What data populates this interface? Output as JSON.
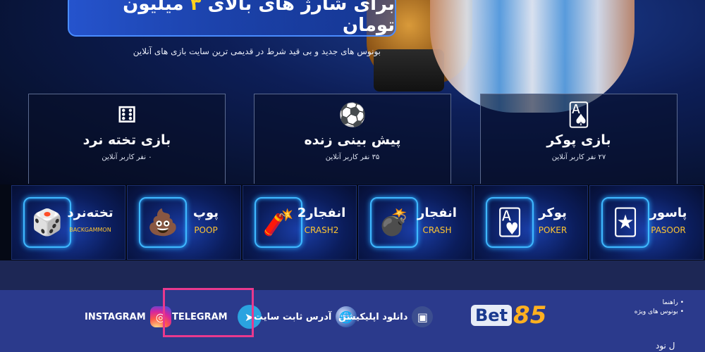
{
  "hero": {
    "promo_title_prefix": "برای شارژ های بالای",
    "promo_title_number": "۳",
    "promo_title_suffix": "میلیون تومان",
    "promo_subtitle": "بونوس های جدید و بی قید شرط در قدیمی ترین سایت بازی های آنلاین"
  },
  "categories": [
    {
      "icon": "dice-icon",
      "glyph": "⚅",
      "title": "بازی تخته نرد",
      "online": "۰ نفر کاربر آنلاین"
    },
    {
      "icon": "soccer-ball-icon",
      "glyph": "⚽",
      "title": "پیش بینی زنده",
      "online": "۳۵ نفر کاربر آنلاین"
    },
    {
      "icon": "playing-cards-icon",
      "glyph": "🂡",
      "title": "بازی پوکر",
      "online": "۲۷ نفر کاربر آنلاین"
    }
  ],
  "games": [
    {
      "name": "تخته‌نرد",
      "sub": "BACKGAMMON",
      "icon": "dice-icon",
      "glyph": "🎲"
    },
    {
      "name": "پوپ",
      "sub": "POOP",
      "icon": "poop-icon",
      "glyph": "💩"
    },
    {
      "name": "انفجار2",
      "sub": "CRASH2",
      "icon": "dynamite-icon",
      "glyph": "🧨"
    },
    {
      "name": "انفجار",
      "sub": "CRASH",
      "icon": "bomb-icon",
      "glyph": "💣"
    },
    {
      "name": "پوکر",
      "sub": "POKER",
      "icon": "poker-chips-icon",
      "glyph": "🂱"
    },
    {
      "name": "پاسور",
      "sub": "PASOOR",
      "icon": "card-fan-icon",
      "glyph": "🃏"
    }
  ],
  "footer": {
    "instagram_label": "INSTAGRAM",
    "telegram_label": "TELEGRAM",
    "address_label": "آدرس ثابت سایت",
    "app_label": "دانلود اپلیکیشن",
    "logo_text": "Bet",
    "logo_num": "85",
    "links": [
      "راهنما",
      "بونوس های ویژه"
    ],
    "more_text": "ل نود"
  },
  "colors": {
    "accent_yellow": "#ffd21e",
    "footer_bg": "#2b3a8c",
    "highlight": "#e8398d",
    "instagram": "#c13584",
    "telegram": "#2aa3e0"
  }
}
